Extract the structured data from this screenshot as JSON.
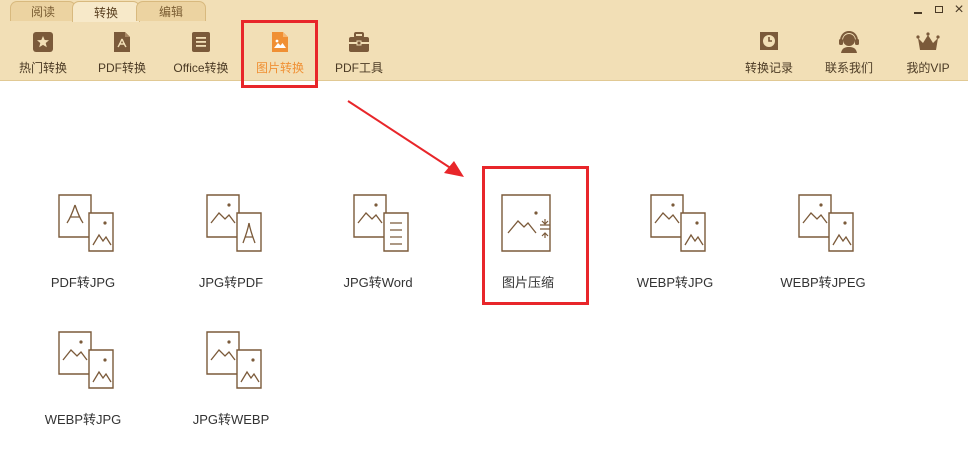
{
  "window": {
    "tabs": [
      {
        "label": "阅读",
        "active": false
      },
      {
        "label": "转换",
        "active": true
      },
      {
        "label": "编辑",
        "active": false
      }
    ],
    "controls": {
      "minimize": "minimize",
      "maximize": "maximize",
      "close": "×"
    }
  },
  "toolbar": {
    "left": [
      {
        "label": "热门转换",
        "icon": "star-icon"
      },
      {
        "label": "PDF转换",
        "icon": "pdf-icon"
      },
      {
        "label": "Office转换",
        "icon": "document-icon"
      },
      {
        "label": "图片转换",
        "icon": "image-icon",
        "selected": true
      },
      {
        "label": "PDF工具",
        "icon": "toolbox-icon"
      }
    ],
    "right": [
      {
        "label": "转换记录",
        "icon": "clock-icon"
      },
      {
        "label": "联系我们",
        "icon": "headset-icon"
      },
      {
        "label": "我的VIP",
        "icon": "crown-icon"
      }
    ]
  },
  "content": {
    "items": [
      {
        "label": "PDF转JPG",
        "icon": "pdf-to-jpg-icon"
      },
      {
        "label": "JPG转PDF",
        "icon": "jpg-to-pdf-icon"
      },
      {
        "label": "JPG转Word",
        "icon": "jpg-to-word-icon"
      },
      {
        "label": "图片压缩",
        "icon": "image-compress-icon",
        "highlighted": true
      },
      {
        "label": "WEBP转JPG",
        "icon": "webp-to-jpg-icon"
      },
      {
        "label": "WEBP转JPEG",
        "icon": "webp-to-jpeg-icon"
      },
      {
        "label": "WEBP转JPG",
        "icon": "webp-to-jpg-icon"
      },
      {
        "label": "JPG转WEBP",
        "icon": "jpg-to-webp-icon"
      }
    ]
  },
  "colors": {
    "header_bg": "#f2dfb6",
    "icon_brown": "#7b5a3a",
    "accent_orange": "#f09034",
    "annotation_red": "#e8262a"
  }
}
